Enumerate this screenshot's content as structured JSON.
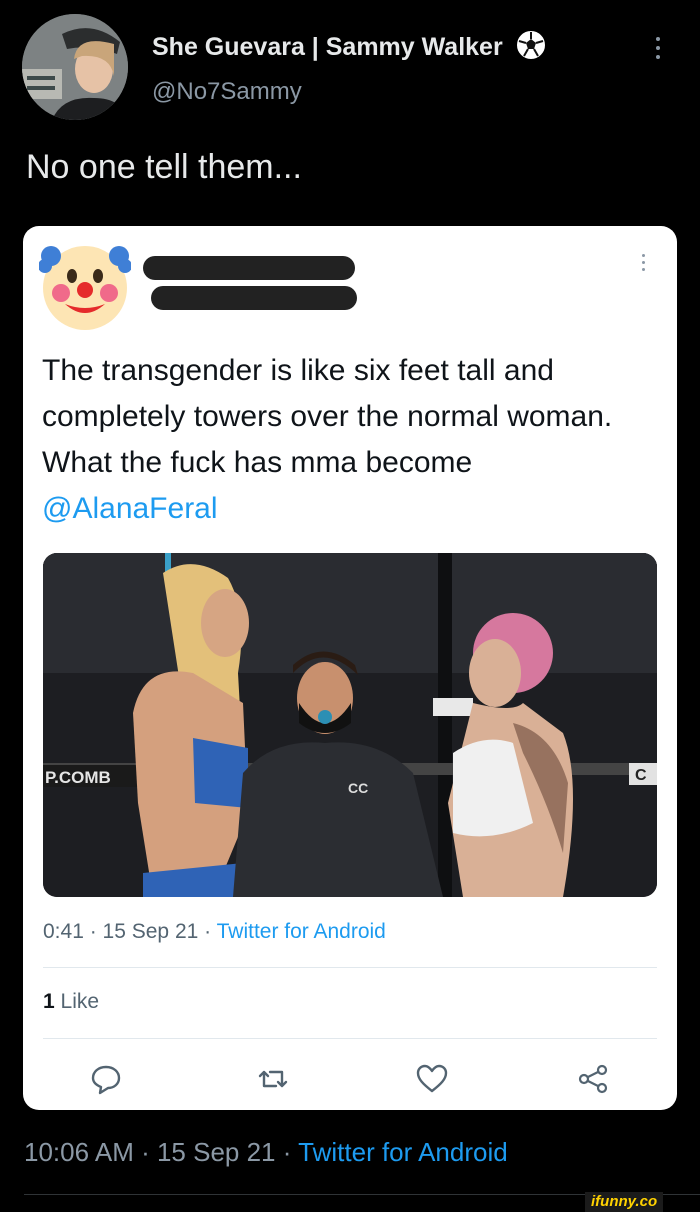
{
  "outer_tweet": {
    "display_name": "She Guevara | Sammy Walker",
    "name_emoji_icon": "soccer-ball-icon",
    "handle": "@No7Sammy",
    "text": "No one tell them...",
    "footer": {
      "time": "10:06 AM",
      "sep1": " · ",
      "date": "15 Sep 21",
      "sep2": " · ",
      "source": "Twitter for Android"
    }
  },
  "quoted_tweet": {
    "avatar_icon": "clown-face-icon",
    "text_before_mention": "The transgender is like six feet tall and completely towers over the normal woman. What the fuck has mma become ",
    "mention": "@AlanaFeral",
    "media_labels": {
      "left_banner": "P.COMB",
      "right_banner": "C",
      "hoodie_logo": "CC"
    },
    "meta": {
      "time": "0:41",
      "sep1": " · ",
      "date": "15 Sep 21",
      "sep2": " · ",
      "source": "Twitter for Android"
    },
    "likes_count": "1",
    "likes_label": " Like",
    "actions": [
      "reply-icon",
      "retweet-icon",
      "like-icon",
      "share-icon"
    ]
  },
  "watermark": "ifunny.co",
  "colors": {
    "background": "#000000",
    "card": "#ffffff",
    "accent": "#1d9bf0",
    "muted": "#8b98a5"
  }
}
